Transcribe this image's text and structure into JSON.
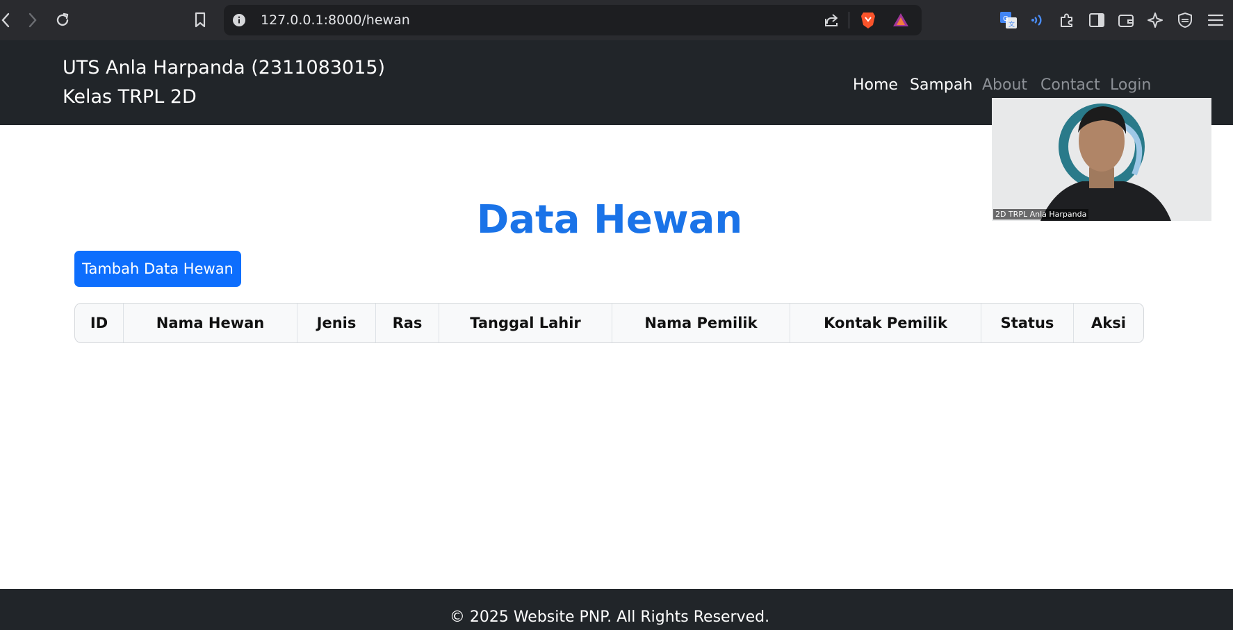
{
  "browser": {
    "url": "127.0.0.1:8000/hewan",
    "icons": [
      "back-icon",
      "forward-icon",
      "reload-icon",
      "bookmark-icon",
      "site-info-icon",
      "share-icon",
      "brave-shield-icon",
      "brave-rewards-icon",
      "translate-icon",
      "speech-icon",
      "extensions-icon",
      "sidebar-icon",
      "wallet-icon",
      "leo-ai-icon",
      "vpn-icon",
      "menu-icon"
    ]
  },
  "navbar": {
    "brand_line1": "UTS Anla Harpanda (2311083015)",
    "brand_line2": "Kelas TRPL 2D",
    "links": [
      "Home",
      "Sampah",
      "About",
      "Contact",
      "Login"
    ]
  },
  "video": {
    "label": "2D TRPL Anla Harpanda"
  },
  "main": {
    "title": "Data Hewan",
    "add_button": "Tambah Data Hewan",
    "table_headers": [
      "ID",
      "Nama Hewan",
      "Jenis",
      "Ras",
      "Tanggal Lahir",
      "Nama Pemilik",
      "Kontak Pemilik",
      "Status",
      "Aksi"
    ]
  },
  "footer": {
    "text": "© 2025 Website PNP. All Rights Reserved."
  },
  "colors": {
    "navbar": "#212529",
    "primary": "#0d6efd",
    "title": "#1a73e8"
  }
}
